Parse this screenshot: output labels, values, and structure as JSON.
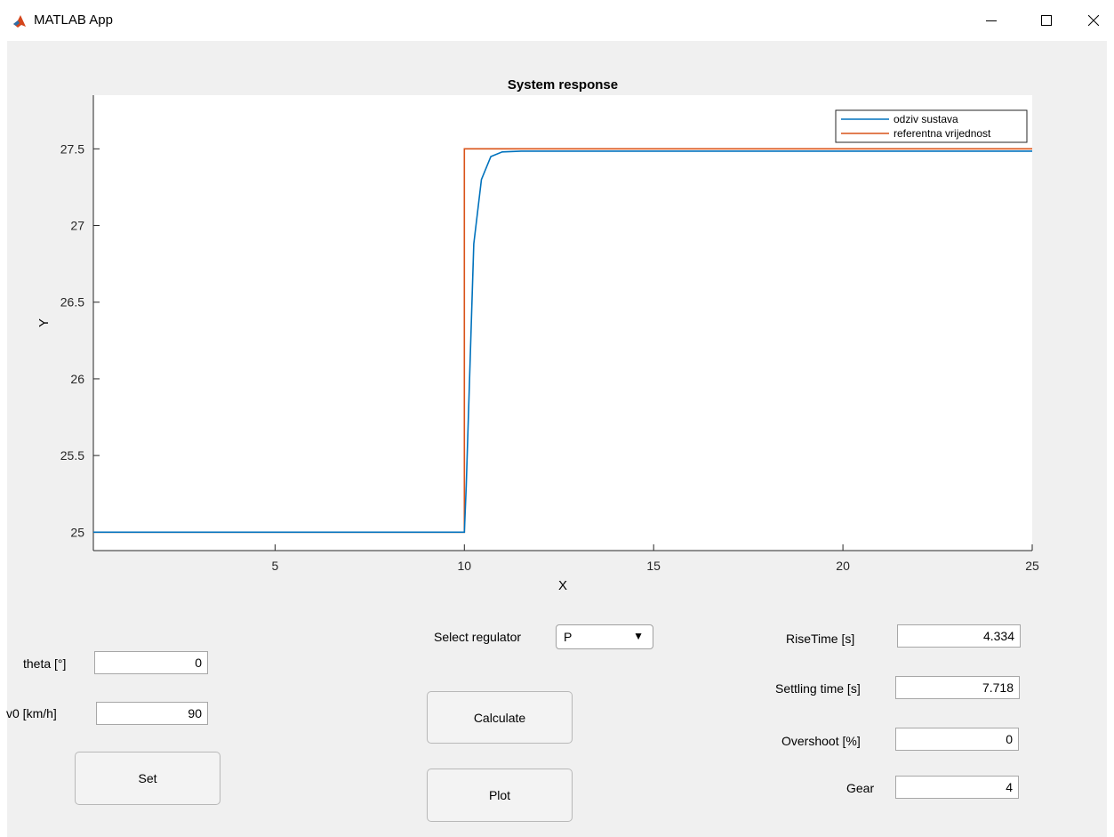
{
  "window": {
    "title": "MATLAB App",
    "controls": [
      "minimize-icon",
      "maximize-icon",
      "close-icon"
    ]
  },
  "chart_data": {
    "type": "line",
    "title": "System response",
    "xlabel": "X",
    "ylabel": "Y",
    "xlim": [
      0.2,
      25
    ],
    "ylim": [
      24.88,
      27.85
    ],
    "xticks": [
      5,
      10,
      15,
      20,
      25
    ],
    "yticks": [
      25,
      25.5,
      26,
      26.5,
      27,
      27.5
    ],
    "grid": false,
    "legend_position": "top-right",
    "series": [
      {
        "name": "odziv sustava",
        "color": "#0072bd",
        "x": [
          0.2,
          10,
          10.05,
          10.25,
          10.45,
          10.7,
          11,
          11.5,
          25
        ],
        "y": [
          25,
          25,
          25.3,
          26.88,
          27.3,
          27.45,
          27.48,
          27.485,
          27.485
        ]
      },
      {
        "name": "referentna vrijednost",
        "color": "#d95319",
        "x": [
          0.2,
          10,
          10,
          25
        ],
        "y": [
          25,
          25,
          27.5,
          27.5
        ]
      }
    ]
  },
  "inputs": {
    "theta_label": "theta [°]",
    "theta_value": "0",
    "v0_label": "v0 [km/h]",
    "v0_value": "90",
    "set_label": "Set"
  },
  "regulator": {
    "label": "Select regulator",
    "selected": "P",
    "arrow": "▼"
  },
  "actions": {
    "calculate_label": "Calculate",
    "plot_label": "Plot"
  },
  "results": {
    "rise_time_label": "RiseTime [s]",
    "rise_time_value": "4.334",
    "settling_time_label": "Settling time [s]",
    "settling_time_value": "7.718",
    "overshoot_label": "Overshoot [%]",
    "overshoot_value": "0",
    "gear_label": "Gear",
    "gear_value": "4"
  }
}
